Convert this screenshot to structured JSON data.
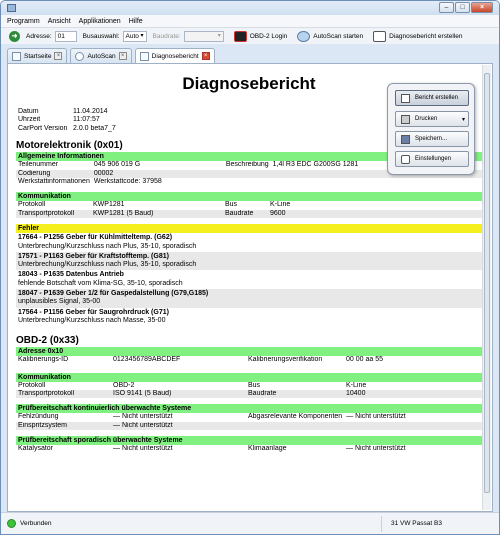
{
  "menu": [
    "Programm",
    "Ansicht",
    "Applikationen",
    "Hilfe"
  ],
  "toolbar": {
    "adresse_label": "Adresse:",
    "adresse_value": "01",
    "busauswahl_label": "Busauswahl:",
    "busauswahl_value": "Auto",
    "baudrate_label": "Baudrate:",
    "baudrate_value": "",
    "obd2_login": "OBD-2 Login",
    "autoscan": "AutoScan starten",
    "diagbericht": "Diagnosebericht erstellen"
  },
  "tabs": [
    {
      "label": "Startseite"
    },
    {
      "label": "AutoScan"
    },
    {
      "label": "Diagnosebericht"
    }
  ],
  "report": {
    "title": "Diagnosebericht",
    "meta": [
      {
        "k": "Datum",
        "v": "11.04.2014"
      },
      {
        "k": "Uhrzeit",
        "v": "11:07:57"
      },
      {
        "k": "CarPort Version",
        "v": "2.0.0 beta7_7"
      }
    ],
    "s1": {
      "title": "Motorelektronik (0x01)",
      "general_title": "Allgemeine Informationen",
      "teil_k": "Teilenummer",
      "teil_v": "045 906 019 G",
      "beschr_k": "Beschreibung",
      "beschr_v": "1,4l R3 EDC G200SG  1281",
      "cod_k": "Codierung",
      "cod_v": "00002",
      "werk_k": "Werkstattinformationen",
      "werk_v": "Werkstattcode: 37958",
      "komm_title": "Kommunikation",
      "prot_k": "Protokoll",
      "prot_v": "KWP1281",
      "bus_k": "Bus",
      "bus_v": "K-Line",
      "tprot_k": "Transportprotokoll",
      "tprot_v": "KWP1281 (5 Baud)",
      "baud_k": "Baudrate",
      "baud_v": "9600",
      "fehler_title": "Fehler",
      "faults": [
        {
          "t": "17664 - P1256 Geber für Kühlmitteltemp. (G62)",
          "d": "Unterbrechung/Kurzschluss nach Plus, 35-10, sporadisch"
        },
        {
          "t": "17571 - P1163 Geber für Kraftstofftemp. (G81)",
          "d": "Unterbrechung/Kurzschluss nach Plus, 35-10, sporadisch"
        },
        {
          "t": "18043 - P1635 Datenbus Antrieb",
          "d": "fehlende Botschaft vom Klima-SG, 35-10, sporadisch"
        },
        {
          "t": "18047 - P1639 Geber 1/2 für Gaspedalstellung (G79,G185)",
          "d": "unplausibles Signal, 35-00"
        },
        {
          "t": "17564 - P1156 Geber für Saugrohrdruck (G71)",
          "d": "Unterbrechung/Kurzschluss nach Masse, 35-00"
        }
      ]
    },
    "s2": {
      "title": "OBD-2 (0x33)",
      "addr_title": "Adresse 0x10",
      "kal_k": "Kalibrierungs-ID",
      "kal_v": "0123456789ABCDEF",
      "kver_k": "Kalibrierungsverifikation",
      "kver_v": "00 00 aa 55",
      "komm_title": "Kommunikation",
      "prot_k": "Protokoll",
      "prot_v": "OBD-2",
      "bus_k": "Bus",
      "bus_v": "K-Line",
      "tprot_k": "Transportprotokoll",
      "tprot_v": "ISO 9141 (5 Baud)",
      "baud_k": "Baudrate",
      "baud_v": "10400",
      "kont_title": "Prüfbereitschaft kontinuierlich überwachte Systeme",
      "fehl_k": "Fehlzündung",
      "fehl_v": "Nicht unterstützt",
      "abg_k": "Abgasrelevante Komponenten",
      "abg_v": "Nicht unterstützt",
      "einspr_k": "Einspritzsystem",
      "einspr_v": "Nicht unterstützt",
      "spor_title": "Prüfbereitschaft sporadisch überwachte Systeme",
      "kat_k": "Katalysator",
      "kat_v": "Nicht unterstützt",
      "klima_k": "Klimaanlage",
      "klima_v": "Nicht unterstützt"
    }
  },
  "popup": {
    "b1": "Bericht erstellen",
    "b2": "Drucken",
    "b3": "Speichern...",
    "b4": "Einstellungen"
  },
  "status": {
    "conn": "Verbunden",
    "car": "31 VW Passat B3"
  },
  "colors": {
    "section_green": "#80f080",
    "section_yellow": "#f5ef1d",
    "status_green": "#3bc43b"
  }
}
